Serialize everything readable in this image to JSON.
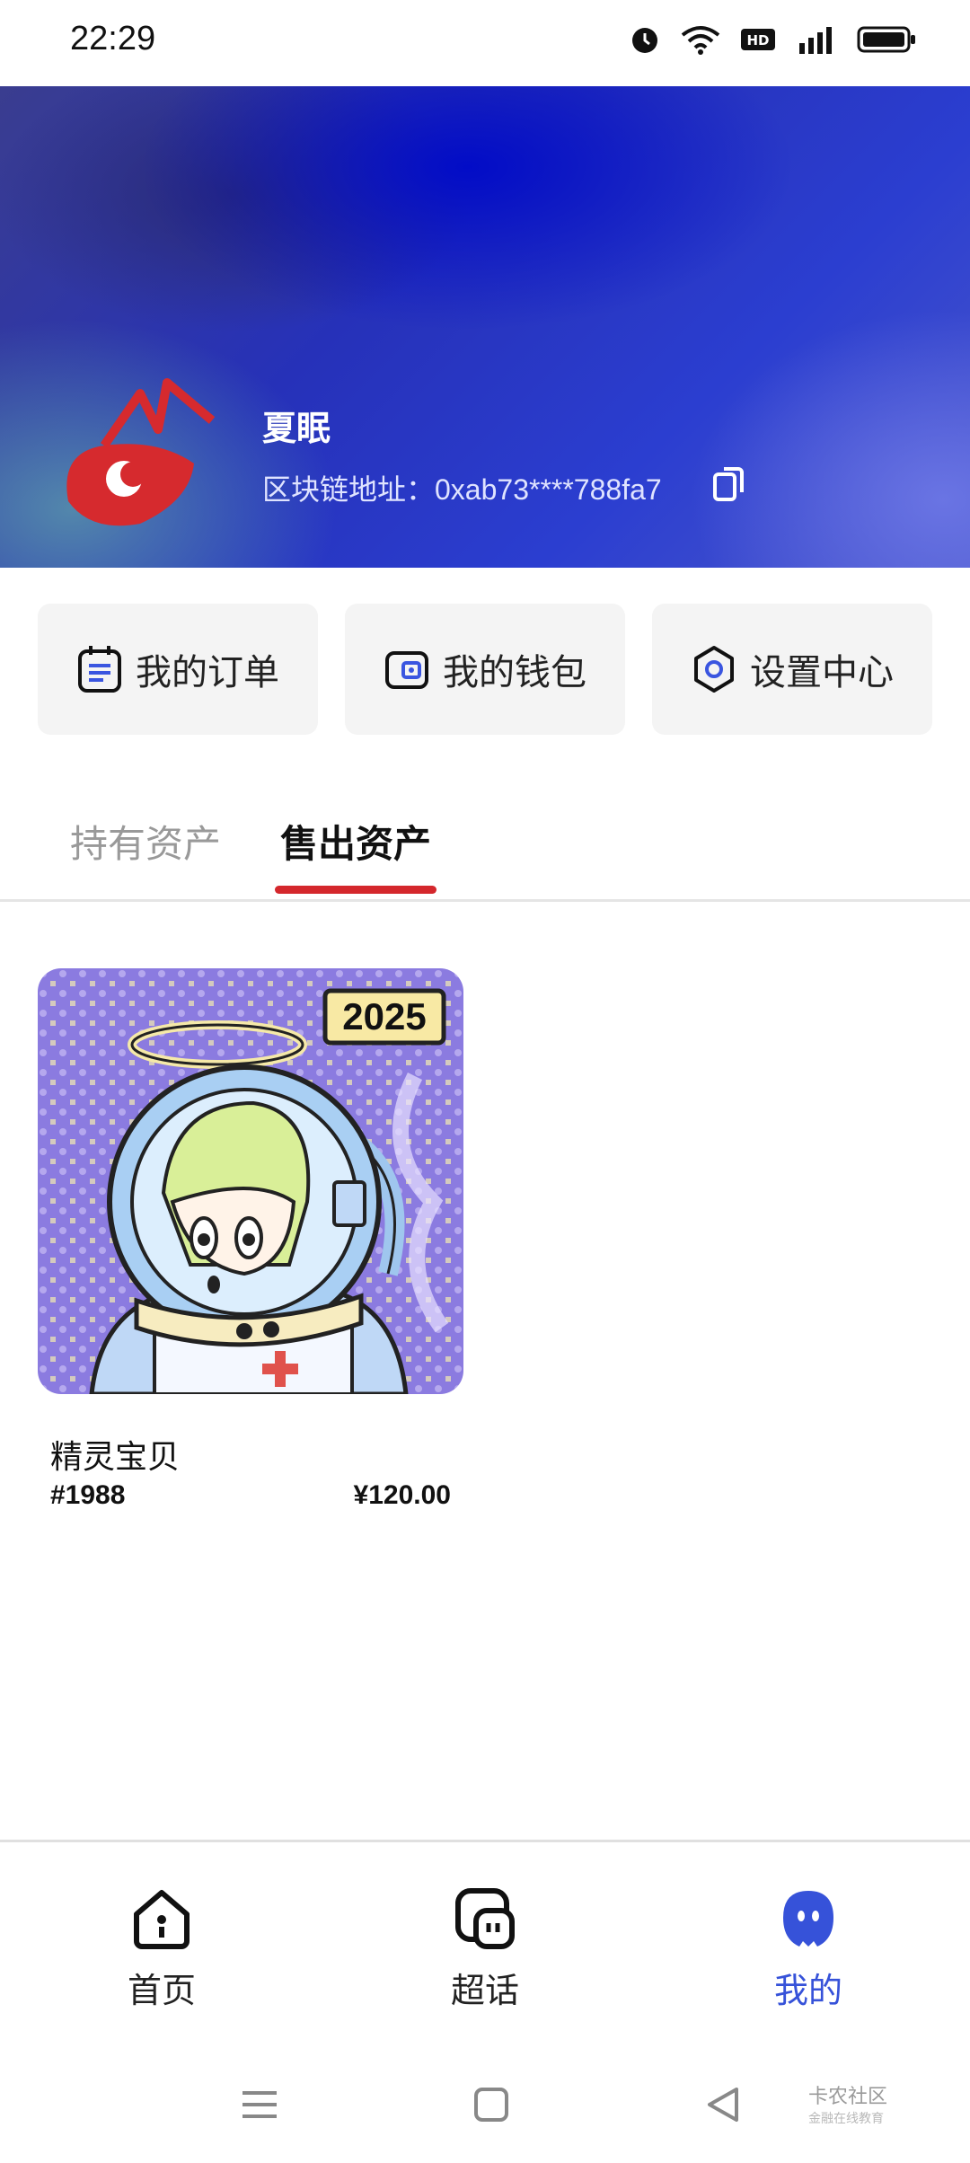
{
  "status_bar": {
    "time": "22:29"
  },
  "profile": {
    "name": "夏眠",
    "chain_address": "区块链地址：0xab73****788fa7"
  },
  "quick_actions": [
    {
      "label": "我的订单",
      "icon": "order-icon"
    },
    {
      "label": "我的钱包",
      "icon": "wallet-icon"
    },
    {
      "label": "设置中心",
      "icon": "settings-icon"
    }
  ],
  "tabs": {
    "held_label": "持有资产",
    "sold_label": "售出资产",
    "active": "售出资产"
  },
  "assets": [
    {
      "badge": "2025",
      "name": "精灵宝贝",
      "serial": "#1988",
      "price": "¥120.00"
    }
  ],
  "bottom_nav": [
    {
      "label": "首页",
      "icon": "home-icon"
    },
    {
      "label": "超话",
      "icon": "topics-icon"
    },
    {
      "label": "我的",
      "icon": "profile-icon"
    }
  ],
  "colors": {
    "accent": "#d4272c",
    "active_nav": "#3652d9"
  },
  "watermark": {
    "line1": "卡农社区",
    "line2": "金融在线教育"
  }
}
